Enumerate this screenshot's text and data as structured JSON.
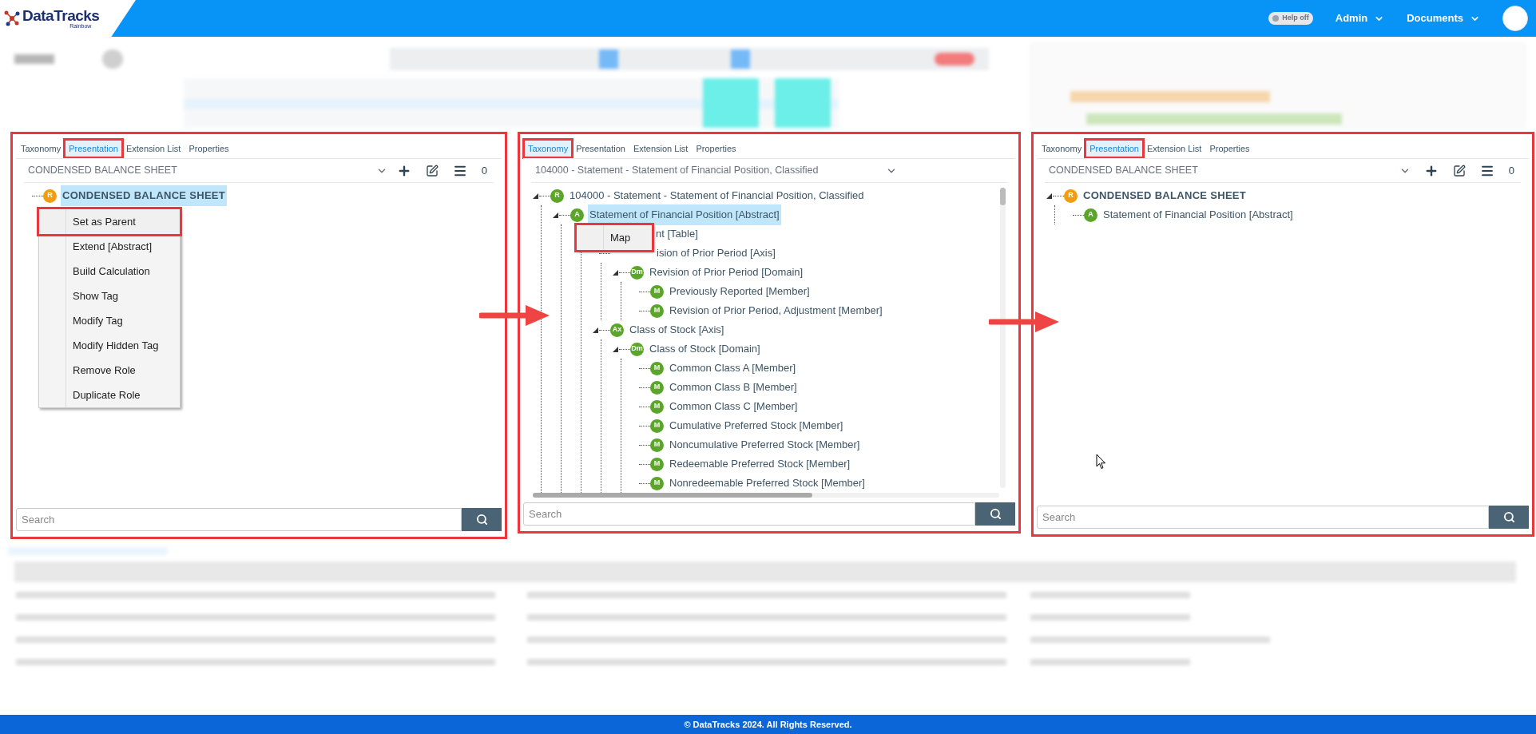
{
  "header": {
    "logo": "DataTracks",
    "logo_sub": "Rainbow",
    "help_toggle": {
      "label": "Help off",
      "on": false
    },
    "menus": [
      "Admin",
      "Documents"
    ]
  },
  "panels": [
    {
      "tabs": [
        {
          "label": "Taxonomy",
          "selected": false
        },
        {
          "label": "Presentation",
          "selected": true
        },
        {
          "label": "Extension List",
          "selected": false
        },
        {
          "label": "Properties",
          "selected": false
        }
      ],
      "dropdown": "CONDENSED BALANCE SHEET",
      "toolbar_count": "0",
      "tree": [
        {
          "badge": "R",
          "color": "#f39c12",
          "label": "CONDENSED BALANCE SHEET",
          "bold": true,
          "selected": true
        }
      ],
      "context_menu": [
        {
          "label": "Set as Parent",
          "highlighted": true
        },
        {
          "label": "Extend [Abstract]",
          "highlighted": false
        },
        {
          "label": "Build Calculation",
          "highlighted": false
        },
        {
          "label": "Show Tag",
          "highlighted": false
        },
        {
          "label": "Modify Tag",
          "highlighted": false
        },
        {
          "label": "Modify Hidden Tag",
          "highlighted": false
        },
        {
          "label": "Remove Role",
          "highlighted": false
        },
        {
          "label": "Duplicate Role",
          "highlighted": false
        }
      ],
      "search": {
        "placeholder": "Search"
      }
    },
    {
      "tabs": [
        {
          "label": "Taxonomy",
          "selected": true
        },
        {
          "label": "Presentation",
          "selected": false
        },
        {
          "label": "Extension List",
          "selected": false
        },
        {
          "label": "Properties",
          "selected": false
        }
      ],
      "dropdown": "104000 - Statement - Statement of Financial Position, Classified",
      "tree": [
        {
          "badge": "R",
          "color": "#5aa52a",
          "label": "104000 - Statement - Statement of Financial Position, Classified",
          "selected": false,
          "expanded": true,
          "children": [
            {
              "badge": "A",
              "color": "#5aa52a",
              "label": "Statement of Financial Position [Abstract]",
              "selected": true,
              "expanded": true,
              "children": [
                {
                  "kind": "covered",
                  "label": "nt [Table]",
                  "selected": false,
                  "children": [
                    {
                      "kind": "covered",
                      "label": "ision of Prior Period [Axis]",
                      "selected": false,
                      "children": [
                        {
                          "badge": "Dm",
                          "color": "#5aa52a",
                          "label": "Revision of Prior Period [Domain]",
                          "selected": false,
                          "expanded": true,
                          "children": [
                            {
                              "badge": "M",
                              "color": "#5aa52a",
                              "label": "Previously Reported [Member]",
                              "selected": false
                            },
                            {
                              "badge": "M",
                              "color": "#5aa52a",
                              "label": "Revision of Prior Period, Adjustment [Member]",
                              "selected": false
                            }
                          ]
                        }
                      ]
                    },
                    {
                      "badge": "Ax",
                      "color": "#5aa52a",
                      "label": "Class of Stock [Axis]",
                      "selected": false,
                      "expanded": true,
                      "children": [
                        {
                          "badge": "Dm",
                          "color": "#5aa52a",
                          "label": "Class of Stock [Domain]",
                          "selected": false,
                          "expanded": true,
                          "children": [
                            {
                              "badge": "M",
                              "color": "#5aa52a",
                              "label": "Common Class A [Member]",
                              "selected": false
                            },
                            {
                              "badge": "M",
                              "color": "#5aa52a",
                              "label": "Common Class B [Member]",
                              "selected": false
                            },
                            {
                              "badge": "M",
                              "color": "#5aa52a",
                              "label": "Common Class C [Member]",
                              "selected": false
                            },
                            {
                              "badge": "M",
                              "color": "#5aa52a",
                              "label": "Cumulative Preferred Stock [Member]",
                              "selected": false
                            },
                            {
                              "badge": "M",
                              "color": "#5aa52a",
                              "label": "Noncumulative Preferred Stock [Member]",
                              "selected": false
                            },
                            {
                              "badge": "M",
                              "color": "#5aa52a",
                              "label": "Redeemable Preferred Stock [Member]",
                              "selected": false
                            },
                            {
                              "badge": "M",
                              "color": "#5aa52a",
                              "label": "Nonredeemable Preferred Stock [Member]",
                              "selected": false
                            }
                          ]
                        }
                      ]
                    }
                  ]
                }
              ]
            }
          ]
        }
      ],
      "context_menu": [
        {
          "label": "Map",
          "highlighted": true
        }
      ],
      "search": {
        "placeholder": "Search"
      }
    },
    {
      "tabs": [
        {
          "label": "Taxonomy",
          "selected": false
        },
        {
          "label": "Presentation",
          "selected": true
        },
        {
          "label": "Extension List",
          "selected": false
        },
        {
          "label": "Properties",
          "selected": false
        }
      ],
      "dropdown": "CONDENSED BALANCE SHEET",
      "toolbar_count": "0",
      "tree": [
        {
          "badge": "R",
          "color": "#f39c12",
          "label": "CONDENSED BALANCE SHEET",
          "bold": true,
          "selected": false,
          "expanded": true,
          "children": [
            {
              "badge": "A",
              "color": "#5aa52a",
              "label": "Statement of Financial Position [Abstract]",
              "selected": false
            }
          ]
        }
      ],
      "search": {
        "placeholder": "Search"
      }
    }
  ],
  "footer": "© DataTracks 2024. All Rights Reserved."
}
